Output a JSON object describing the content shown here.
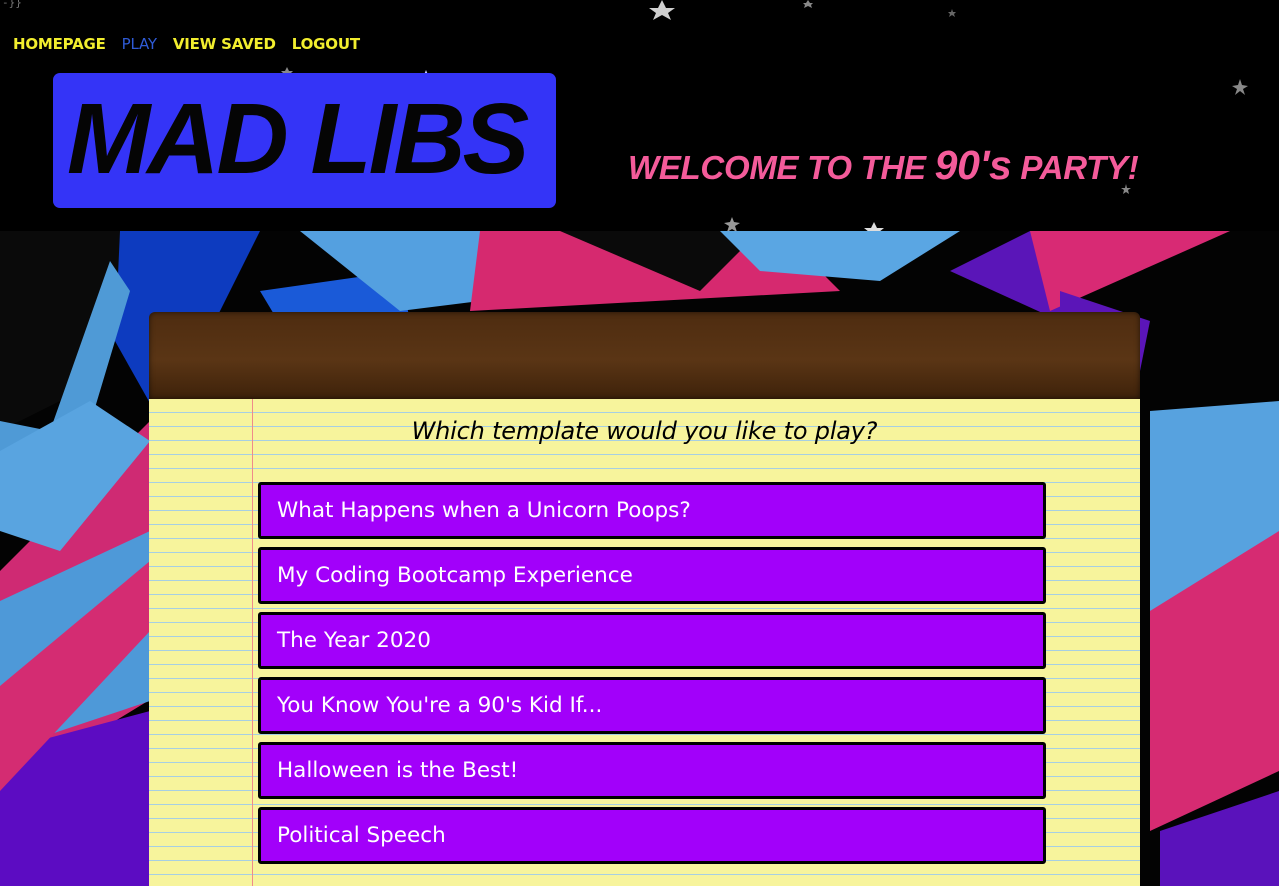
{
  "stray_text": "-}}",
  "nav": {
    "homepage": "HOMEPAGE",
    "play": "PLAY",
    "view_saved": "VIEW SAVED",
    "logout": "LOGOUT",
    "active": "play"
  },
  "logo": {
    "text": "MAD LIBS"
  },
  "welcome": {
    "part1": "WELCOME TO THE ",
    "part2": "90's",
    "part3": " PARTY!"
  },
  "notepad": {
    "question": "Which template would you like to play?",
    "templates": [
      "What Happens when a Unicorn Poops?",
      "My Coding Bootcamp Experience",
      "The Year 2020",
      "You Know You're a 90's Kid If...",
      "Halloween is the Best!",
      "Political Speech"
    ]
  },
  "colors": {
    "nav_link": "#f2ee2e",
    "nav_active": "#2f5bd6",
    "logo_bg": "#3434f7",
    "welcome_text": "#f45b9a",
    "template_button": "#a200fa",
    "paper": "#f7f49c",
    "clipboard_top": "#5a3515"
  }
}
